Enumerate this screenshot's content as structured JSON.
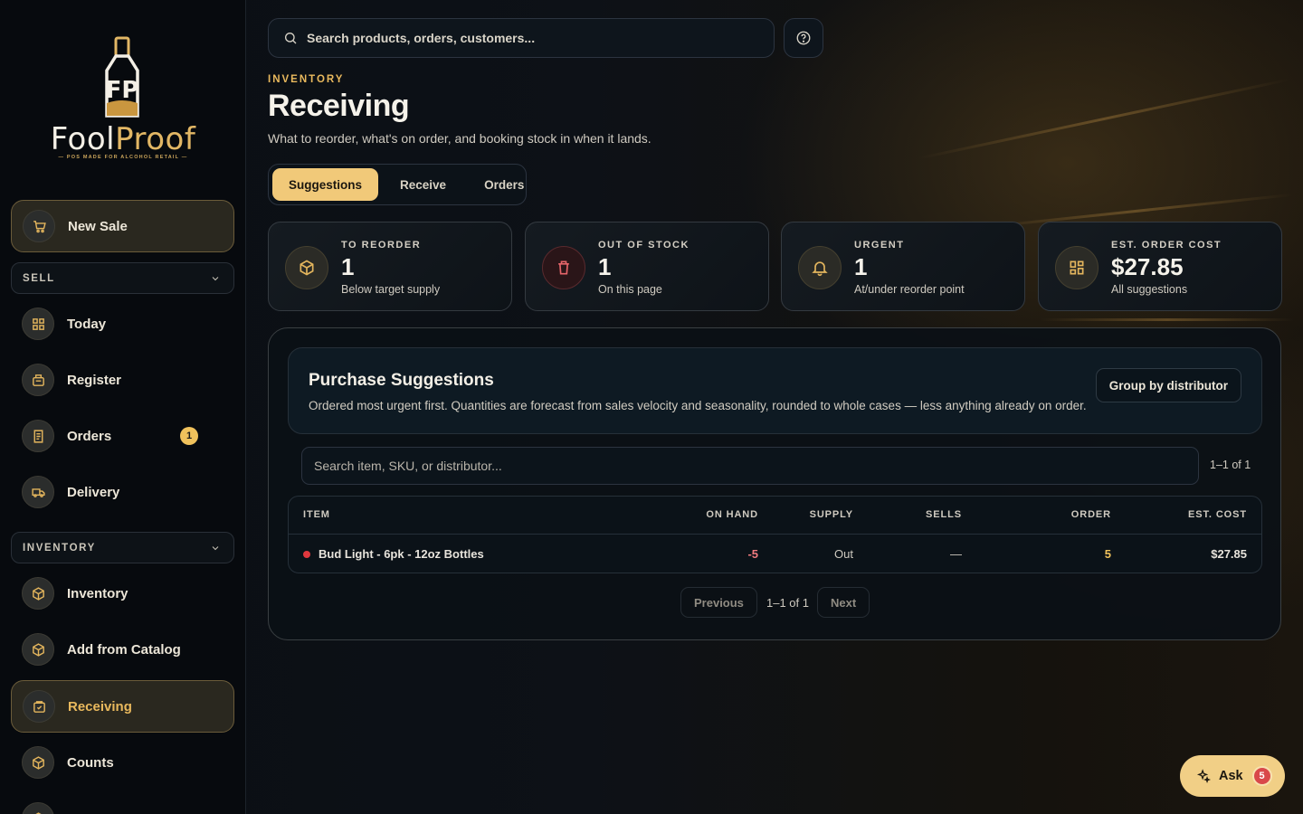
{
  "brand": {
    "name_prefix": "Fool",
    "name_suffix": "Proof",
    "tagline": "POS MADE FOR ALCOHOL RETAIL",
    "accent": "#e3b55d"
  },
  "sidebar": {
    "new_sale": {
      "label": "New Sale",
      "icon": "cart-icon"
    },
    "sections": [
      {
        "title": "SELL",
        "items": [
          {
            "label": "Today",
            "icon": "grid-icon"
          },
          {
            "label": "Register",
            "icon": "register-icon"
          },
          {
            "label": "Orders",
            "icon": "receipt-icon",
            "badge": "1"
          },
          {
            "label": "Delivery",
            "icon": "truck-icon"
          }
        ]
      },
      {
        "title": "INVENTORY",
        "items": [
          {
            "label": "Inventory",
            "icon": "box-icon"
          },
          {
            "label": "Add from Catalog",
            "icon": "box-icon"
          },
          {
            "label": "Receiving",
            "icon": "receiving-icon",
            "active": true
          },
          {
            "label": "Counts",
            "icon": "box-icon"
          }
        ]
      }
    ]
  },
  "search": {
    "placeholder": "Search products, orders, customers..."
  },
  "header": {
    "eyebrow": "INVENTORY",
    "title": "Receiving",
    "subtitle": "What to reorder, what's on order, and booking stock in when it lands."
  },
  "tabs": [
    {
      "label": "Suggestions",
      "active": true
    },
    {
      "label": "Receive"
    },
    {
      "label": "Orders"
    }
  ],
  "stats": [
    {
      "label": "TO REORDER",
      "value": "1",
      "note": "Below target supply",
      "icon": "box-icon"
    },
    {
      "label": "OUT OF STOCK",
      "value": "1",
      "note": "On this page",
      "icon": "trash-icon"
    },
    {
      "label": "URGENT",
      "value": "1",
      "note": "At/under reorder point",
      "icon": "bell-icon"
    },
    {
      "label": "EST. ORDER COST",
      "value": "$27.85",
      "note": "All suggestions",
      "icon": "grid-icon"
    }
  ],
  "suggestions": {
    "title": "Purchase Suggestions",
    "description": "Ordered most urgent first. Quantities are forecast from sales velocity and seasonality, rounded to whole cases — less anything already on order.",
    "group_button": "Group by distributor",
    "filter_placeholder": "Search item, SKU, or distributor...",
    "count": "1–1 of 1",
    "columns": [
      "ITEM",
      "ON HAND",
      "SUPPLY",
      "SELLS",
      "ORDER",
      "EST. COST"
    ],
    "rows": [
      {
        "item": "Bud Light - 6pk - 12oz Bottles",
        "on_hand": "-5",
        "supply": "Out",
        "sells": "—",
        "order": "5",
        "est_cost": "$27.85",
        "status_color": "#e0383e"
      }
    ],
    "pager": {
      "previous": "Previous",
      "range": "1–1 of 1",
      "next": "Next"
    }
  },
  "assistant": {
    "label": "Ask",
    "badge": "5"
  }
}
